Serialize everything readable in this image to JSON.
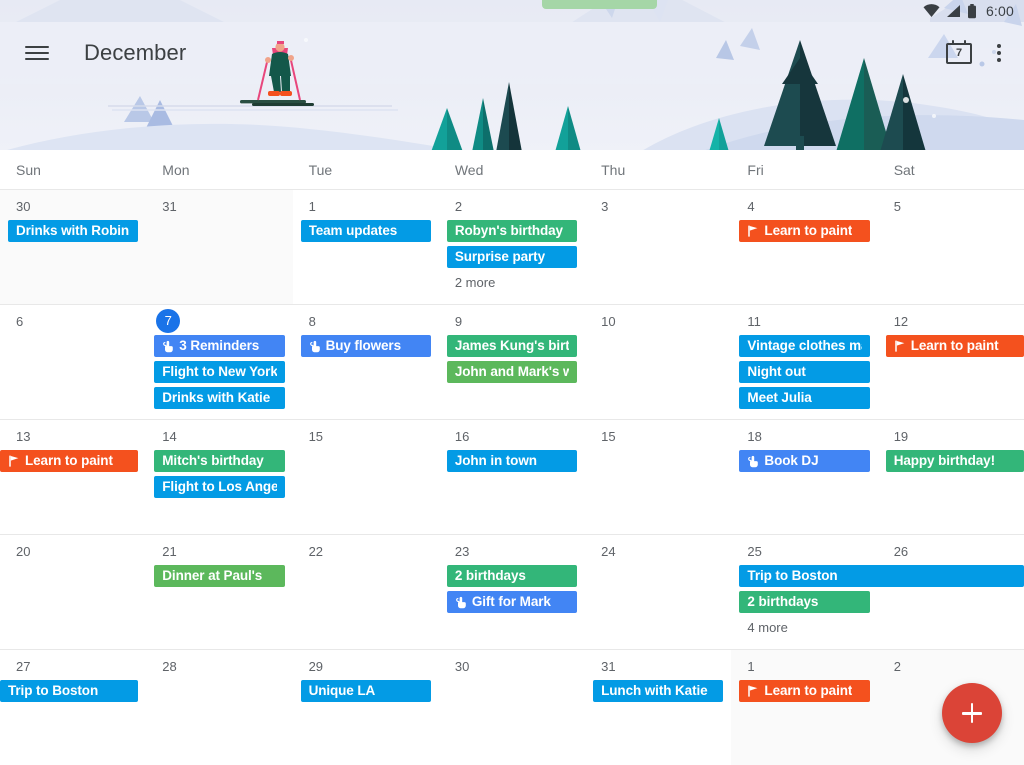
{
  "statusbar": {
    "time": "6:00",
    "icons": [
      "wifi-icon",
      "cell-signal-icon",
      "battery-icon"
    ]
  },
  "appbar": {
    "menu_icon": "hamburger-menu-icon",
    "title": "December",
    "today_icon_day": "7",
    "overflow_icon": "overflow-menu-icon"
  },
  "weekdays": [
    "Sun",
    "Mon",
    "Tue",
    "Wed",
    "Thu",
    "Fri",
    "Sat"
  ],
  "colors": {
    "event_blue": "#039be5",
    "reminder_blue": "#4285f4",
    "birthday_green": "#33b679",
    "event_green": "#5cb85c",
    "goal_orange": "#f4511e",
    "today_blue": "#1a73e8",
    "fab_red": "#db4437"
  },
  "fab": {
    "label": "+",
    "name": "create-event-fab"
  },
  "weeks": [
    {
      "days": [
        {
          "num": "30",
          "other_month": true
        },
        {
          "num": "31",
          "other_month": true
        },
        {
          "num": "1"
        },
        {
          "num": "2",
          "more": "2 more"
        },
        {
          "num": "3"
        },
        {
          "num": "4"
        },
        {
          "num": "5"
        }
      ],
      "events": [
        {
          "title": "Drinks with Robin",
          "col": 0,
          "span": 1,
          "row": 0,
          "type": "event",
          "color": "#039be5"
        },
        {
          "title": "Team updates",
          "col": 2,
          "span": 1,
          "row": 0,
          "type": "event",
          "color": "#039be5"
        },
        {
          "title": "Robyn's birthday",
          "col": 3,
          "span": 1,
          "row": 0,
          "type": "birthday",
          "color": "#33b679"
        },
        {
          "title": "Surprise party",
          "col": 3,
          "span": 1,
          "row": 1,
          "type": "event",
          "color": "#039be5"
        },
        {
          "title": "Learn to paint",
          "col": 5,
          "span": 1,
          "row": 0,
          "type": "goal",
          "color": "#f4511e"
        }
      ]
    },
    {
      "days": [
        {
          "num": "6"
        },
        {
          "num": "7",
          "today": true
        },
        {
          "num": "8"
        },
        {
          "num": "9"
        },
        {
          "num": "10"
        },
        {
          "num": "11"
        },
        {
          "num": "12"
        }
      ],
      "events": [
        {
          "title": "3 Reminders",
          "col": 1,
          "span": 1,
          "row": 0,
          "type": "reminder",
          "color": "#4285f4"
        },
        {
          "title": "Flight to New York",
          "col": 1,
          "span": 1,
          "row": 1,
          "type": "event",
          "color": "#039be5"
        },
        {
          "title": "Drinks with Katie",
          "col": 1,
          "span": 1,
          "row": 2,
          "type": "event",
          "color": "#039be5"
        },
        {
          "title": "Buy flowers",
          "col": 2,
          "span": 1,
          "row": 0,
          "type": "reminder",
          "color": "#4285f4"
        },
        {
          "title": "James Kung's birth",
          "col": 3,
          "span": 1,
          "row": 0,
          "type": "birthday",
          "color": "#33b679"
        },
        {
          "title": "John and Mark's we",
          "col": 3,
          "span": 1,
          "row": 1,
          "type": "event",
          "color": "#5cb85c"
        },
        {
          "title": "Vintage clothes ma",
          "col": 5,
          "span": 1,
          "row": 0,
          "type": "event",
          "color": "#039be5"
        },
        {
          "title": "Night out",
          "col": 5,
          "span": 1,
          "row": 1,
          "type": "event",
          "color": "#039be5"
        },
        {
          "title": "Meet Julia",
          "col": 5,
          "span": 1,
          "row": 2,
          "type": "event",
          "color": "#039be5"
        },
        {
          "title": "Learn to paint",
          "col": 6,
          "span": 1,
          "row": 0,
          "type": "goal",
          "color": "#f4511e",
          "bleed_right": true
        }
      ]
    },
    {
      "days": [
        {
          "num": "13"
        },
        {
          "num": "14"
        },
        {
          "num": "15"
        },
        {
          "num": "16"
        },
        {
          "num": "15"
        },
        {
          "num": "18"
        },
        {
          "num": "19"
        }
      ],
      "events": [
        {
          "title": "Learn to paint",
          "col": 0,
          "span": 1,
          "row": 0,
          "type": "goal",
          "color": "#f4511e",
          "bleed_left": true
        },
        {
          "title": "Mitch's birthday",
          "col": 1,
          "span": 1,
          "row": 0,
          "type": "birthday",
          "color": "#33b679"
        },
        {
          "title": "Flight to Los Angele",
          "col": 1,
          "span": 1,
          "row": 1,
          "type": "event",
          "color": "#039be5"
        },
        {
          "title": "John in town",
          "col": 3,
          "span": 1,
          "row": 0,
          "type": "event",
          "color": "#039be5"
        },
        {
          "title": "Book DJ",
          "col": 5,
          "span": 1,
          "row": 0,
          "type": "reminder",
          "color": "#4285f4"
        },
        {
          "title": "Happy birthday!",
          "col": 6,
          "span": 1,
          "row": 0,
          "type": "birthday",
          "color": "#33b679",
          "bleed_right": true
        }
      ]
    },
    {
      "days": [
        {
          "num": "20"
        },
        {
          "num": "21"
        },
        {
          "num": "22"
        },
        {
          "num": "23"
        },
        {
          "num": "24"
        },
        {
          "num": "25",
          "more": "4 more"
        },
        {
          "num": "26"
        }
      ],
      "events": [
        {
          "title": "Dinner at Paul's",
          "col": 1,
          "span": 1,
          "row": 0,
          "type": "event",
          "color": "#5cb85c"
        },
        {
          "title": "2 birthdays",
          "col": 3,
          "span": 1,
          "row": 0,
          "type": "birthday",
          "color": "#33b679"
        },
        {
          "title": "Gift for Mark",
          "col": 3,
          "span": 1,
          "row": 1,
          "type": "reminder",
          "color": "#4285f4"
        },
        {
          "title": "Trip to Boston",
          "col": 5,
          "span": 2,
          "row": 0,
          "type": "event",
          "color": "#039be5",
          "bleed_right": true
        },
        {
          "title": "2 birthdays",
          "col": 5,
          "span": 1,
          "row": 1,
          "type": "birthday",
          "color": "#33b679"
        }
      ]
    },
    {
      "days": [
        {
          "num": "27"
        },
        {
          "num": "28"
        },
        {
          "num": "29"
        },
        {
          "num": "30"
        },
        {
          "num": "31"
        },
        {
          "num": "1",
          "other_month": true
        },
        {
          "num": "2",
          "other_month": true
        }
      ],
      "events": [
        {
          "title": "Trip to Boston",
          "col": 0,
          "span": 1,
          "row": 0,
          "type": "event",
          "color": "#039be5",
          "bleed_left": true
        },
        {
          "title": "Unique LA",
          "col": 2,
          "span": 1,
          "row": 0,
          "type": "event",
          "color": "#039be5"
        },
        {
          "title": "Lunch with Katie",
          "col": 4,
          "span": 1,
          "row": 0,
          "type": "event",
          "color": "#039be5"
        },
        {
          "title": "Learn to paint",
          "col": 5,
          "span": 1,
          "row": 0,
          "type": "goal",
          "color": "#f4511e"
        }
      ]
    }
  ]
}
